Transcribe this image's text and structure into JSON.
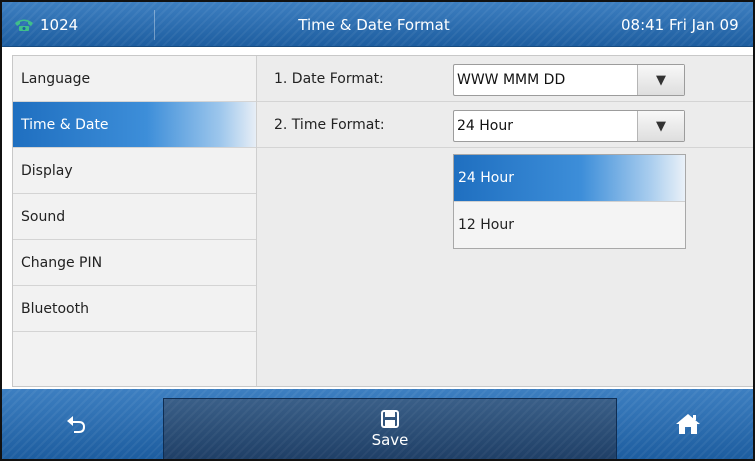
{
  "status_bar": {
    "extension": "1024",
    "title": "Time & Date Format",
    "clock": "08:41 Fri Jan 09"
  },
  "sidebar": {
    "items": [
      {
        "label": "Language",
        "active": false
      },
      {
        "label": "Time & Date",
        "active": true
      },
      {
        "label": "Display",
        "active": false
      },
      {
        "label": "Sound",
        "active": false
      },
      {
        "label": "Change PIN",
        "active": false
      },
      {
        "label": "Bluetooth",
        "active": false
      }
    ]
  },
  "settings": {
    "date_format": {
      "label": "1. Date Format:",
      "value": "WWW MMM DD"
    },
    "time_format": {
      "label": "2. Time Format:",
      "value": "24 Hour"
    }
  },
  "time_format_dropdown": {
    "options": [
      {
        "label": "24 Hour",
        "selected": true
      },
      {
        "label": "12 Hour",
        "selected": false
      }
    ]
  },
  "softkeys": {
    "back_icon": "back-arrow-icon",
    "save_label": "Save",
    "save_icon": "floppy-disk-icon",
    "home_icon": "home-icon"
  },
  "colors": {
    "bar_blue": "#2d6eb0",
    "highlight_blue": "#1f6fc0",
    "phone_icon_green": "#3fbf8a"
  }
}
